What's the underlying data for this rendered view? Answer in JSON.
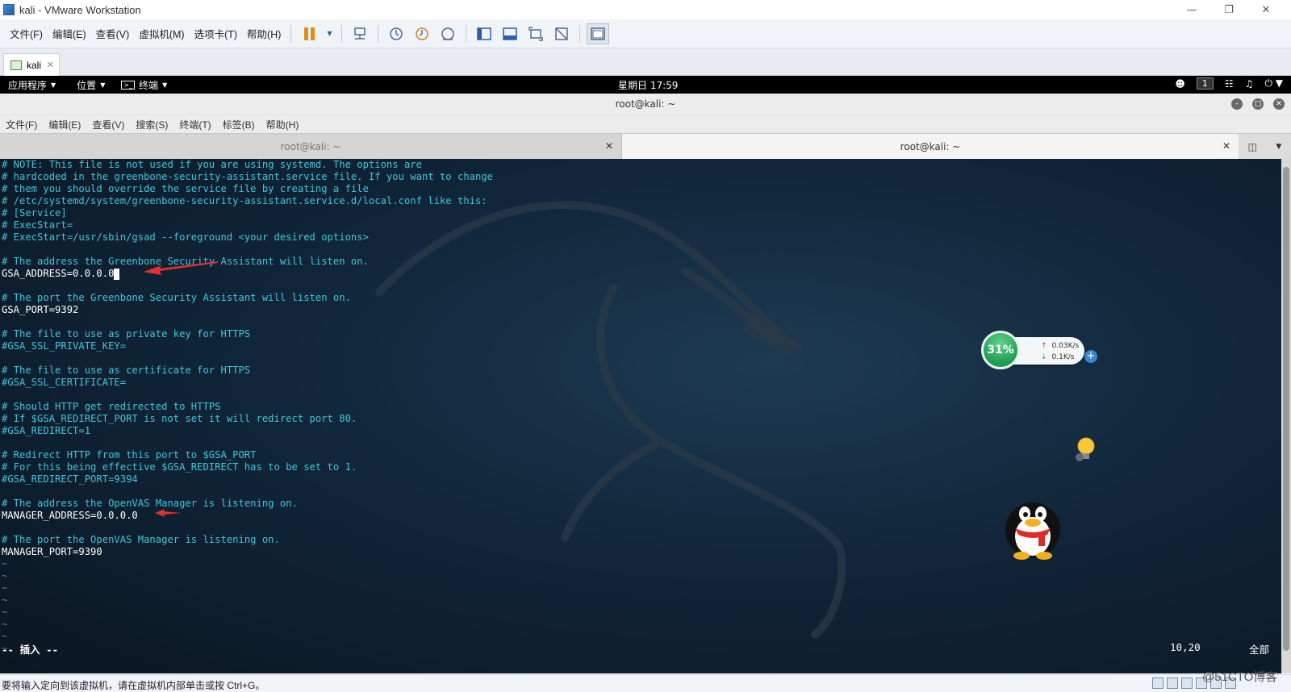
{
  "vmware": {
    "title": "kali - VMware Workstation",
    "menu": [
      "文件(F)",
      "编辑(E)",
      "查看(V)",
      "虚拟机(M)",
      "选项卡(T)",
      "帮助(H)"
    ],
    "tab_label": "kali",
    "status_text": "要将输入定向到该虚拟机，请在虚拟机内部单击或按 Ctrl+G。"
  },
  "kali_panel": {
    "apps": "应用程序",
    "places": "位置",
    "terminal": "终端",
    "clock": "星期日 17:59",
    "workspace": "1"
  },
  "terminal": {
    "title": "root@kali: ~",
    "menu": [
      "文件(F)",
      "编辑(E)",
      "查看(V)",
      "搜索(S)",
      "终端(T)",
      "标签(B)",
      "帮助(H)"
    ],
    "tabs": [
      {
        "label": "root@kali: ~",
        "active": false
      },
      {
        "label": "root@kali: ~",
        "active": true
      }
    ],
    "lines": [
      {
        "type": "comment",
        "text": "# NOTE: This file is not used if you are using systemd. The options are"
      },
      {
        "type": "comment",
        "text": "# hardcoded in the greenbone-security-assistant.service file. If you want to change"
      },
      {
        "type": "comment",
        "text": "# them you should override the service file by creating a file"
      },
      {
        "type": "comment",
        "text": "# /etc/systemd/system/greenbone-security-assistant.service.d/local.conf like this:"
      },
      {
        "type": "comment",
        "text": "# [Service]"
      },
      {
        "type": "comment",
        "text": "# ExecStart="
      },
      {
        "type": "comment",
        "text": "# ExecStart=/usr/sbin/gsad --foreground <your desired options>"
      },
      {
        "type": "blank",
        "text": ""
      },
      {
        "type": "comment",
        "text": "# The address the Greenbone Security Assistant will listen on."
      },
      {
        "type": "code",
        "text": "GSA_ADDRESS=0.0.0.0",
        "cursor": true
      },
      {
        "type": "blank",
        "text": ""
      },
      {
        "type": "comment",
        "text": "# The port the Greenbone Security Assistant will listen on."
      },
      {
        "type": "code",
        "text": "GSA_PORT=9392"
      },
      {
        "type": "blank",
        "text": ""
      },
      {
        "type": "comment",
        "text": "# The file to use as private key for HTTPS"
      },
      {
        "type": "comment",
        "text": "#GSA_SSL_PRIVATE_KEY="
      },
      {
        "type": "blank",
        "text": ""
      },
      {
        "type": "comment",
        "text": "# The file to use as certificate for HTTPS"
      },
      {
        "type": "comment",
        "text": "#GSA_SSL_CERTIFICATE="
      },
      {
        "type": "blank",
        "text": ""
      },
      {
        "type": "comment",
        "text": "# Should HTTP get redirected to HTTPS"
      },
      {
        "type": "comment",
        "text": "# If $GSA_REDIRECT_PORT is not set it will redirect port 80."
      },
      {
        "type": "comment",
        "text": "#GSA_REDIRECT=1"
      },
      {
        "type": "blank",
        "text": ""
      },
      {
        "type": "comment",
        "text": "# Redirect HTTP from this port to $GSA_PORT"
      },
      {
        "type": "comment",
        "text": "# For this being effective $GSA_REDIRECT has to be set to 1."
      },
      {
        "type": "comment",
        "text": "#GSA_REDIRECT_PORT=9394"
      },
      {
        "type": "blank",
        "text": ""
      },
      {
        "type": "comment",
        "text": "# The address the OpenVAS Manager is listening on."
      },
      {
        "type": "code",
        "text": "MANAGER_ADDRESS=0.0.0.0"
      },
      {
        "type": "blank",
        "text": ""
      },
      {
        "type": "comment",
        "text": "# The port the OpenVAS Manager is listening on."
      },
      {
        "type": "code",
        "text": "MANAGER_PORT=9390"
      },
      {
        "type": "tilde",
        "text": "~"
      },
      {
        "type": "tilde",
        "text": "~"
      },
      {
        "type": "tilde",
        "text": "~"
      },
      {
        "type": "tilde",
        "text": "~"
      },
      {
        "type": "tilde",
        "text": "~"
      },
      {
        "type": "tilde",
        "text": "~"
      },
      {
        "type": "tilde",
        "text": "~"
      },
      {
        "type": "tilde",
        "text": "~"
      }
    ],
    "mode": "-- 插入 --",
    "position": "10,20",
    "scroll_pos": "全部"
  },
  "speed_widget": {
    "percent": "31%",
    "up": "0.03K/s",
    "down": "0.1K/s"
  },
  "watermark": "@51CTO博客",
  "colors": {
    "comment": "#3fc6d8",
    "code": "#ffffff",
    "arrow": "#e03030",
    "terminal_bg": "#11263a"
  }
}
